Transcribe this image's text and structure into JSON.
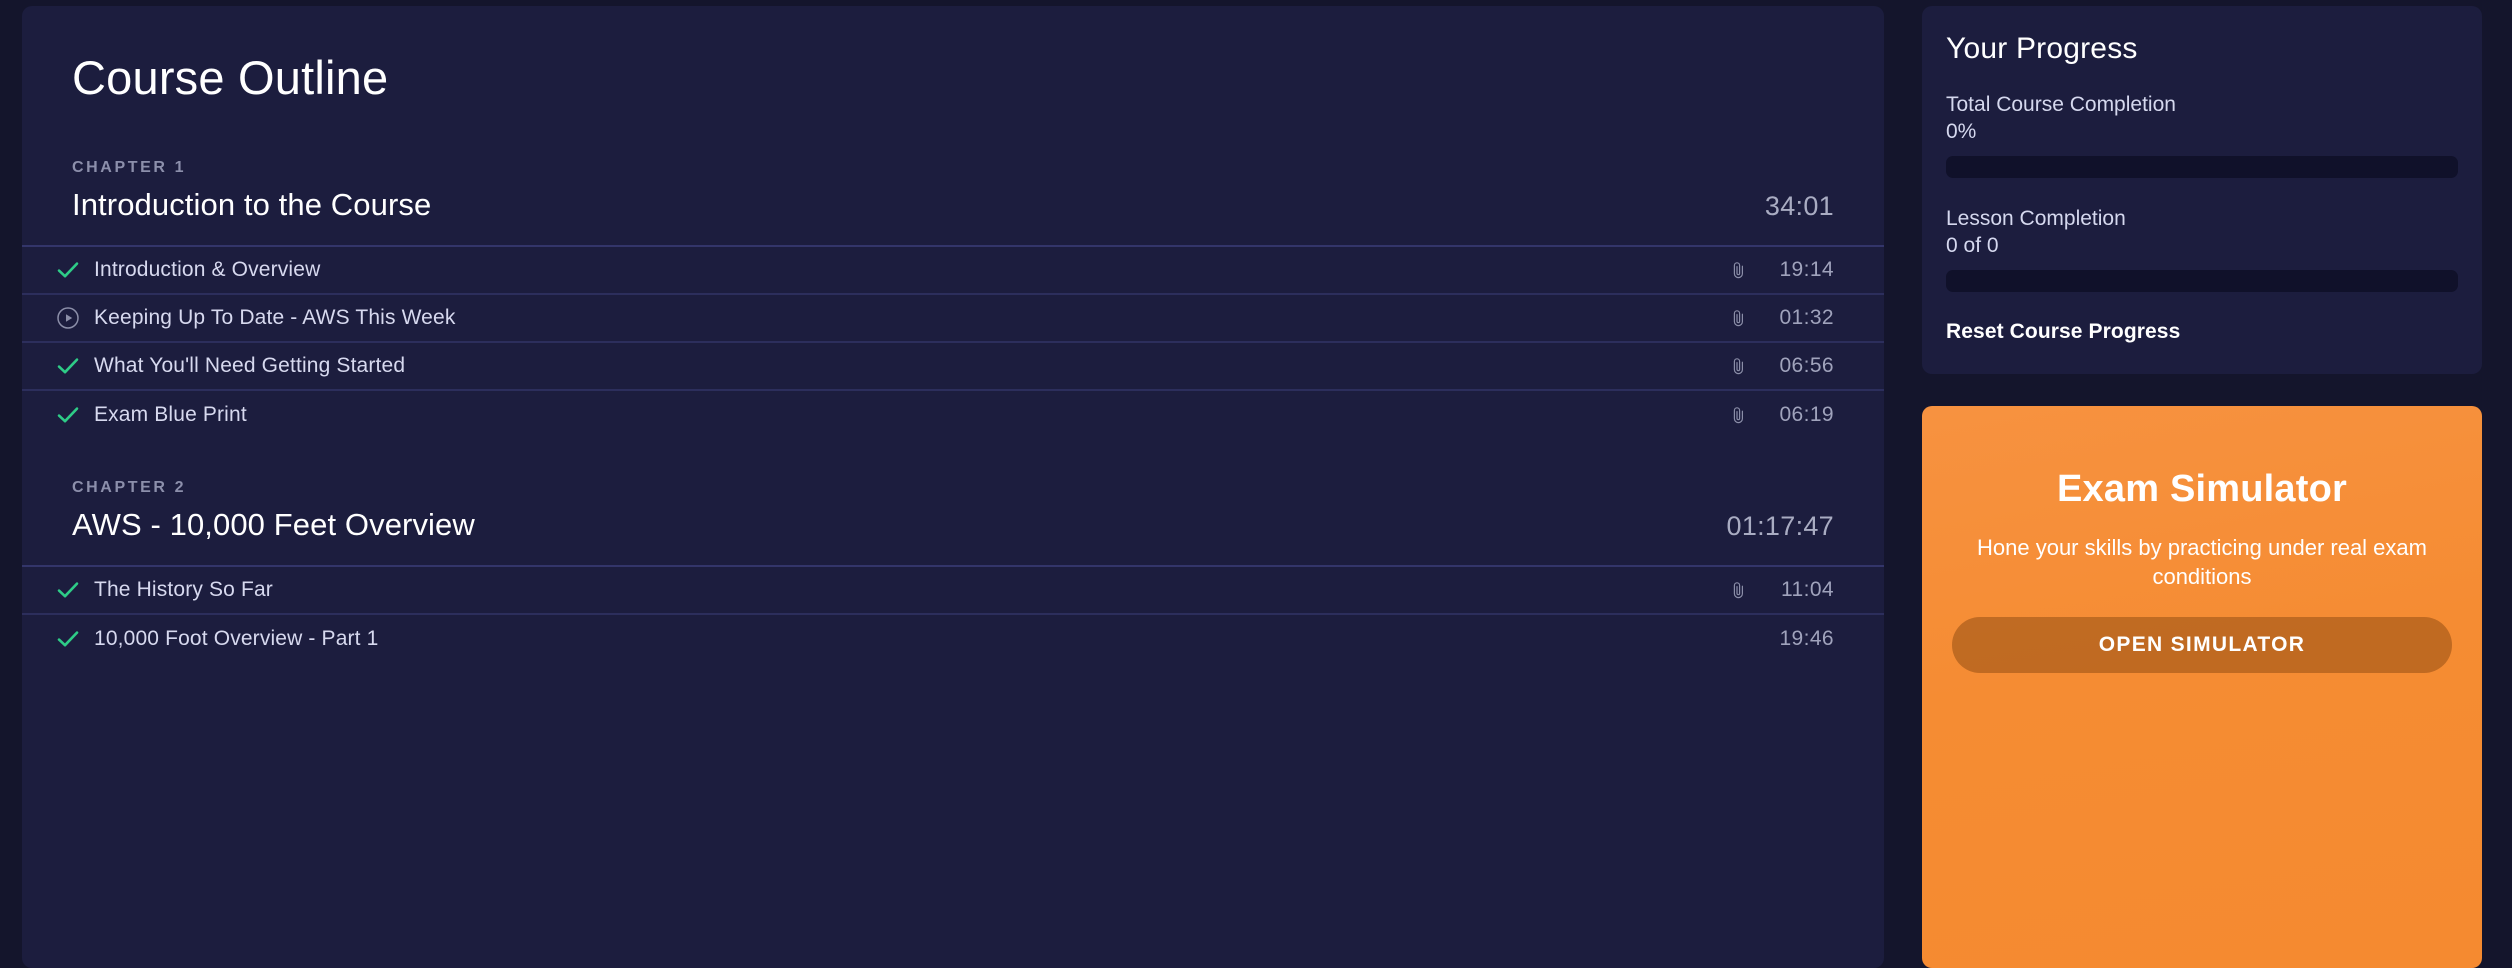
{
  "outline": {
    "title": "Course Outline",
    "chapters": [
      {
        "kicker": "CHAPTER 1",
        "name": "Introduction to the Course",
        "duration": "34:01",
        "lessons": [
          {
            "status": "complete",
            "label": "Introduction & Overview",
            "attachment": true,
            "duration": "19:14"
          },
          {
            "status": "play",
            "label": "Keeping Up To Date - AWS This Week",
            "attachment": true,
            "duration": "01:32"
          },
          {
            "status": "complete",
            "label": "What You'll Need Getting Started",
            "attachment": true,
            "duration": "06:56"
          },
          {
            "status": "complete",
            "label": "Exam Blue Print",
            "attachment": true,
            "duration": "06:19"
          }
        ]
      },
      {
        "kicker": "CHAPTER 2",
        "name": "AWS - 10,000 Feet Overview",
        "duration": "01:17:47",
        "lessons": [
          {
            "status": "complete",
            "label": "The History So Far",
            "attachment": true,
            "duration": "11:04"
          },
          {
            "status": "complete",
            "label": "10,000 Foot Overview - Part 1",
            "attachment": false,
            "duration": "19:46"
          }
        ]
      }
    ]
  },
  "progress": {
    "title": "Your Progress",
    "total_label": "Total Course Completion",
    "total_value": "0%",
    "total_percent": 0,
    "lesson_label": "Lesson Completion",
    "lesson_value": "0 of 0",
    "lesson_percent": 0,
    "reset_label": "Reset Course Progress"
  },
  "simulator": {
    "title": "Exam Simulator",
    "subtitle": "Hone your skills by practicing under real exam conditions",
    "button_label": "OPEN SIMULATOR"
  },
  "colors": {
    "page_bg": "#14152c",
    "panel_bg": "#1c1d3e",
    "divider": "#2c2e5c",
    "check_green": "#2ecc87",
    "accent_orange": "#f5922f",
    "text_primary": "#ffffff",
    "text_muted": "#a0a3bc"
  },
  "icons": {
    "check": "check-icon",
    "play": "play-circle-icon",
    "attachment": "paperclip-icon"
  }
}
